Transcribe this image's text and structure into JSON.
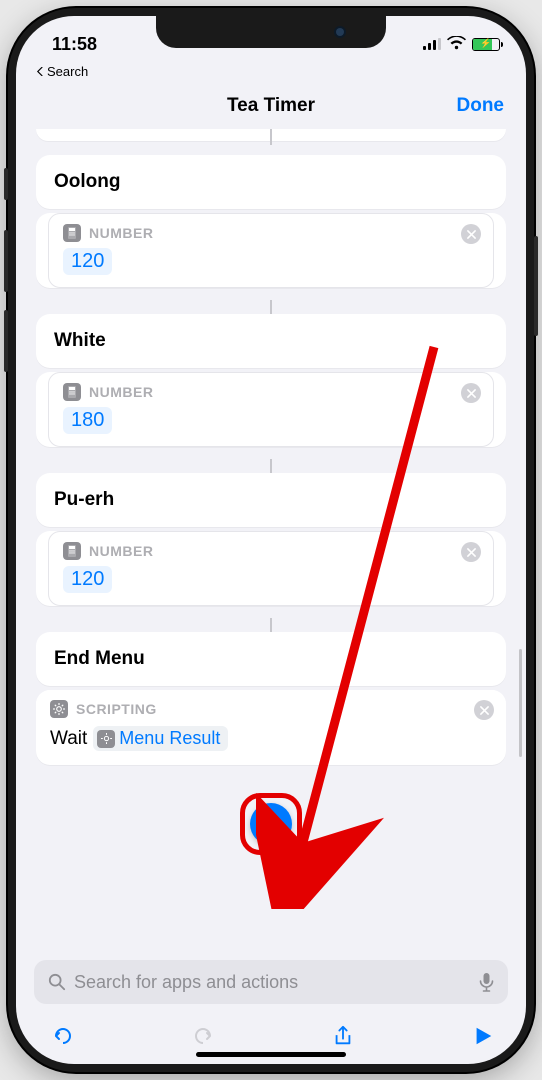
{
  "status": {
    "time": "11:58"
  },
  "breadcrumb": {
    "label": "Search"
  },
  "nav": {
    "title": "Tea Timer",
    "done": "Done"
  },
  "actions": {
    "number_label": "NUMBER",
    "scripting_label": "SCRIPTING",
    "groups": [
      {
        "title": "Oolong",
        "value": "120"
      },
      {
        "title": "White",
        "value": "180"
      },
      {
        "title": "Pu-erh",
        "value": "120"
      }
    ],
    "end_menu": "End Menu",
    "wait": {
      "prefix": "Wait",
      "token": "Menu Result"
    }
  },
  "search": {
    "placeholder": "Search for apps and actions"
  }
}
